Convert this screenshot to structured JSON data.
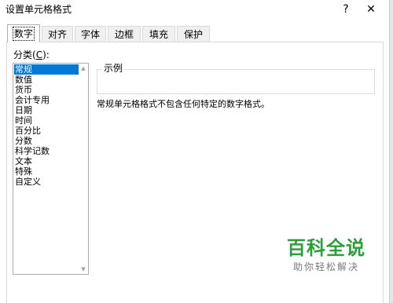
{
  "window": {
    "title": "设置单元格格式",
    "help_label": "?",
    "close_label": "✕"
  },
  "tabs": [
    {
      "label": "数字",
      "active": true
    },
    {
      "label": "对齐",
      "active": false
    },
    {
      "label": "字体",
      "active": false
    },
    {
      "label": "边框",
      "active": false
    },
    {
      "label": "填充",
      "active": false
    },
    {
      "label": "保护",
      "active": false
    }
  ],
  "category": {
    "label_prefix": "分类(",
    "label_accel": "C",
    "label_suffix": "):",
    "items": [
      "常规",
      "数值",
      "货币",
      "会计专用",
      "日期",
      "时间",
      "百分比",
      "分数",
      "科学记数",
      "文本",
      "特殊",
      "自定义"
    ],
    "selected_index": 0
  },
  "sample": {
    "label": "示例",
    "value": ""
  },
  "description": "常规单元格格式不包含任何特定的数字格式。",
  "scrollbar": {
    "up_icon": "▲",
    "down_icon": "▼"
  },
  "watermark": {
    "title": "百科全说",
    "subtitle": "助你轻松解决"
  },
  "colors": {
    "selection": "#0078d7",
    "watermark_green": "#2c9f3c"
  }
}
